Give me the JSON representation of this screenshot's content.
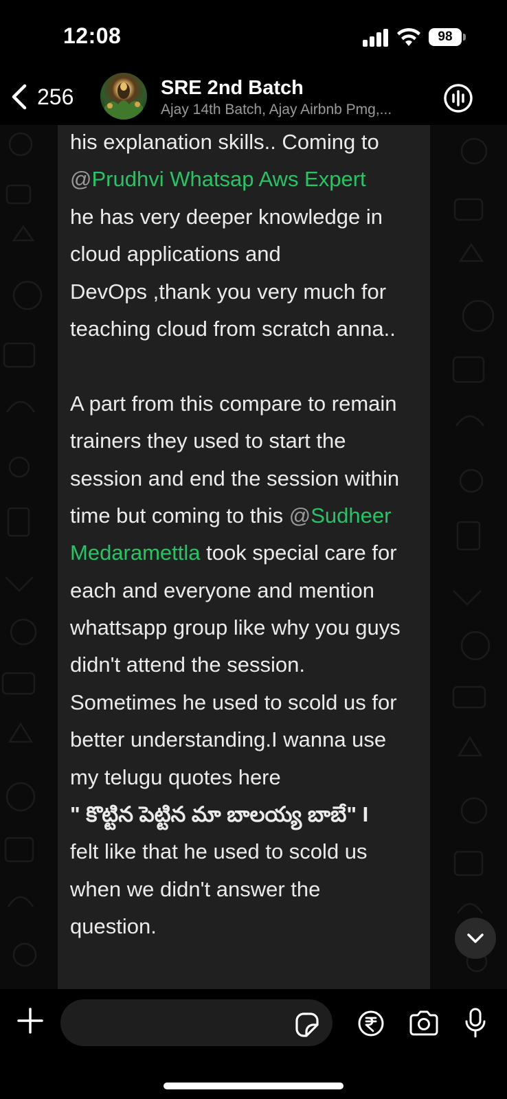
{
  "status_bar": {
    "time": "12:08",
    "battery": "98"
  },
  "header": {
    "back_count": "256",
    "title": "SRE 2nd Batch",
    "subtitle": "Ajay 14th Batch, Ajay Airbnb Pmg,..."
  },
  "message": {
    "lines": [
      {
        "segments": [
          {
            "t": "his explanation skills.. Coming to"
          }
        ]
      },
      {
        "segments": [
          {
            "t": "@",
            "at": true
          },
          {
            "t": "Prudhvi Whatsap Aws Expert",
            "mention": true
          }
        ]
      },
      {
        "segments": [
          {
            "t": "he has very deeper knowledge in"
          }
        ]
      },
      {
        "segments": [
          {
            "t": "cloud applications and"
          }
        ]
      },
      {
        "segments": [
          {
            "t": "DevOps ,thank you very much for"
          }
        ]
      },
      {
        "segments": [
          {
            "t": "teaching cloud from scratch anna.."
          }
        ]
      },
      {
        "segments": [
          {
            "t": ""
          }
        ]
      },
      {
        "segments": [
          {
            "t": "A part from this compare to remain"
          }
        ]
      },
      {
        "segments": [
          {
            "t": "trainers they used to start the"
          }
        ]
      },
      {
        "segments": [
          {
            "t": "session and end the session within"
          }
        ]
      },
      {
        "segments": [
          {
            "t": "time but coming to this "
          },
          {
            "t": "@",
            "at": true
          },
          {
            "t": "Sudheer",
            "mention": true
          }
        ]
      },
      {
        "segments": [
          {
            "t": "Medaramettla",
            "mention": true
          },
          {
            "t": " took special care for"
          }
        ]
      },
      {
        "segments": [
          {
            "t": "each and everyone and mention"
          }
        ]
      },
      {
        "segments": [
          {
            "t": "whattsapp group like why you guys"
          }
        ]
      },
      {
        "segments": [
          {
            "t": "didn't attend the session."
          }
        ]
      },
      {
        "segments": [
          {
            "t": "Sometimes he used to scold us for"
          }
        ]
      },
      {
        "segments": [
          {
            "t": "better understanding.I wanna use"
          }
        ]
      },
      {
        "segments": [
          {
            "t": "my telugu quotes here"
          }
        ]
      },
      {
        "segments": [
          {
            "t": "\" కొట్టిన పెట్టిన మా బాలయ్య బాబే\"  I",
            "bold": true
          }
        ]
      },
      {
        "segments": [
          {
            "t": "felt like that he used to scold us"
          }
        ]
      },
      {
        "segments": [
          {
            "t": "when we didn't answer the"
          }
        ]
      },
      {
        "segments": [
          {
            "t": "question."
          }
        ]
      }
    ]
  },
  "composer": {
    "placeholder": ""
  },
  "colors": {
    "mention": "#25c565",
    "bubble": "#202020",
    "background": "#0b0b0b"
  },
  "icons": {
    "back": "chevron-left-icon",
    "call": "group-call-icon",
    "scroll": "chevron-down-icon",
    "plus": "plus-icon",
    "sticker": "sticker-icon",
    "payment": "rupee-icon",
    "camera": "camera-icon",
    "mic": "microphone-icon"
  }
}
